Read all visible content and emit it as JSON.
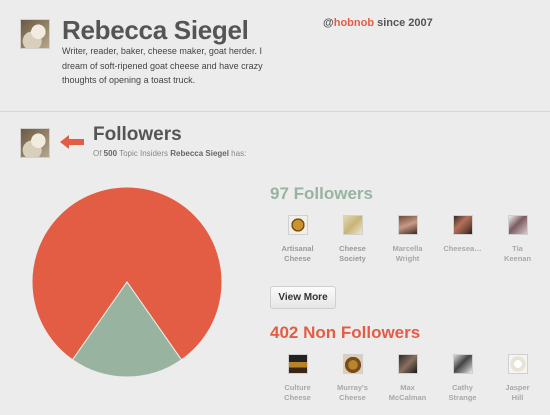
{
  "profile": {
    "name": "Rebecca Siegel",
    "handle_prefix": "@",
    "handle_brand": "hobnob",
    "handle_suffix": " since 2007",
    "bio": "Writer, reader, baker, cheese maker, goat herder. I dream of soft-ripened goat cheese and have crazy thoughts of opening a toast truck."
  },
  "followers_section": {
    "title": "Followers",
    "subtitle_of": "Of ",
    "subtitle_count": "500",
    "subtitle_mid": " Topic Insiders ",
    "subtitle_name": "Rebecca Siegel",
    "subtitle_end": " has:"
  },
  "chart_data": {
    "type": "pie",
    "slices": [
      {
        "label": "Non Followers",
        "value": 402,
        "color": "#e35d45"
      },
      {
        "label": "Followers",
        "value": 97,
        "color": "#98b4a0"
      }
    ]
  },
  "followers": {
    "heading": "97 Followers",
    "items": [
      {
        "name_1": "Artisanal",
        "name_2": "Cheese",
        "icon": "artisanal-cheese-logo"
      },
      {
        "name_1": "Cheese",
        "name_2": "Society",
        "icon": "cheese-society-photo"
      },
      {
        "name_1": "Marcella",
        "name_2": "Wright",
        "icon": "marcella-wright-avatar"
      },
      {
        "name_1": "Cheesea…",
        "name_2": "",
        "icon": "cheesea-avatar"
      },
      {
        "name_1": "Tia",
        "name_2": "Keenan",
        "icon": "tia-keenan-avatar"
      }
    ],
    "view_more_label": "View More"
  },
  "non_followers": {
    "heading": "402 Non Followers",
    "items": [
      {
        "name_1": "Culture",
        "name_2": "Cheese",
        "icon": "culture-cheese-logo"
      },
      {
        "name_1": "Murray's",
        "name_2": "Cheese",
        "icon": "murrays-cheese-logo"
      },
      {
        "name_1": "Max",
        "name_2": "McCalman",
        "icon": "max-mccalman-avatar"
      },
      {
        "name_1": "Cathy",
        "name_2": "Strange",
        "icon": "cathy-strange-avatar"
      },
      {
        "name_1": "Jasper",
        "name_2": "Hill",
        "icon": "jasper-hill-logo"
      }
    ]
  },
  "colors": {
    "accent_red": "#e35d45",
    "accent_green": "#98b4a0"
  }
}
